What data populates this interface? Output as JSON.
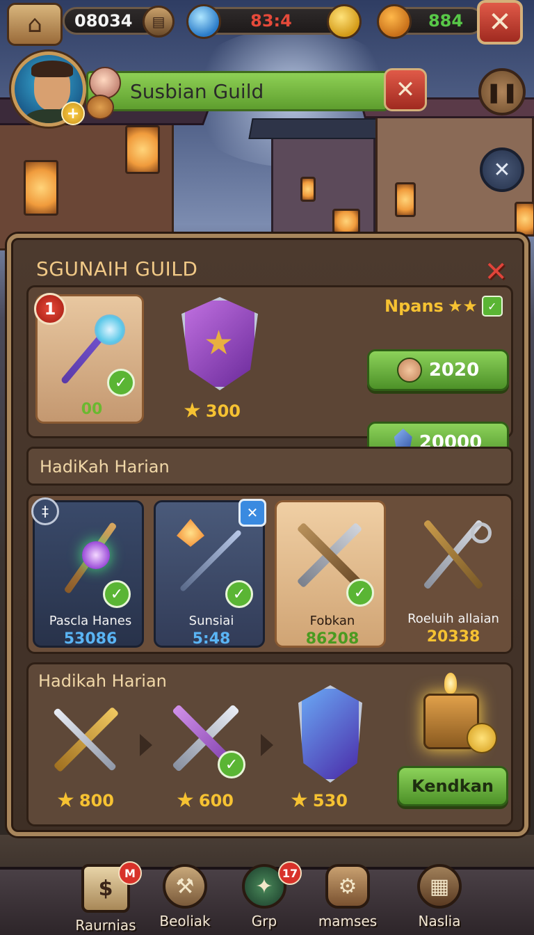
{
  "topbar": {
    "currency1": "08034",
    "currency2": "83:4",
    "currency3": "884"
  },
  "profile": {
    "guild_name": "Susbian Guild"
  },
  "panel": {
    "title": "SGUNAIH GUILD",
    "rank_badge": "1",
    "item1_value": "00",
    "item2_stars": "300",
    "npans_label": "Npans",
    "btn1_value": "2020",
    "btn2_value": "20000",
    "section1_label": "HadiKah Harian",
    "weapons": [
      {
        "name": "Pascla Hanes",
        "value": "53086"
      },
      {
        "name": "Sunsiai",
        "value": "5:48"
      },
      {
        "name": "Fobkan",
        "value": "86208"
      },
      {
        "name": "Roeluih allaian",
        "value": "20338"
      }
    ],
    "section2_label": "Hadikah Harian",
    "rewards": [
      {
        "stars": "800"
      },
      {
        "stars": "600"
      },
      {
        "stars": "530"
      }
    ],
    "claim_button": "Kendkan"
  },
  "nav": {
    "items": [
      {
        "label": "Raurnias",
        "badge": "M"
      },
      {
        "label": "Beoliak"
      },
      {
        "label": "Grp",
        "badge": "17"
      },
      {
        "label": "mamses"
      },
      {
        "label": "Naslia"
      }
    ]
  },
  "colors": {
    "gold": "#f6c232",
    "green_button": "#6bb63a",
    "red_close": "#d8322a",
    "panel_bg": "#46352a",
    "panel_border": "#a8865c"
  }
}
